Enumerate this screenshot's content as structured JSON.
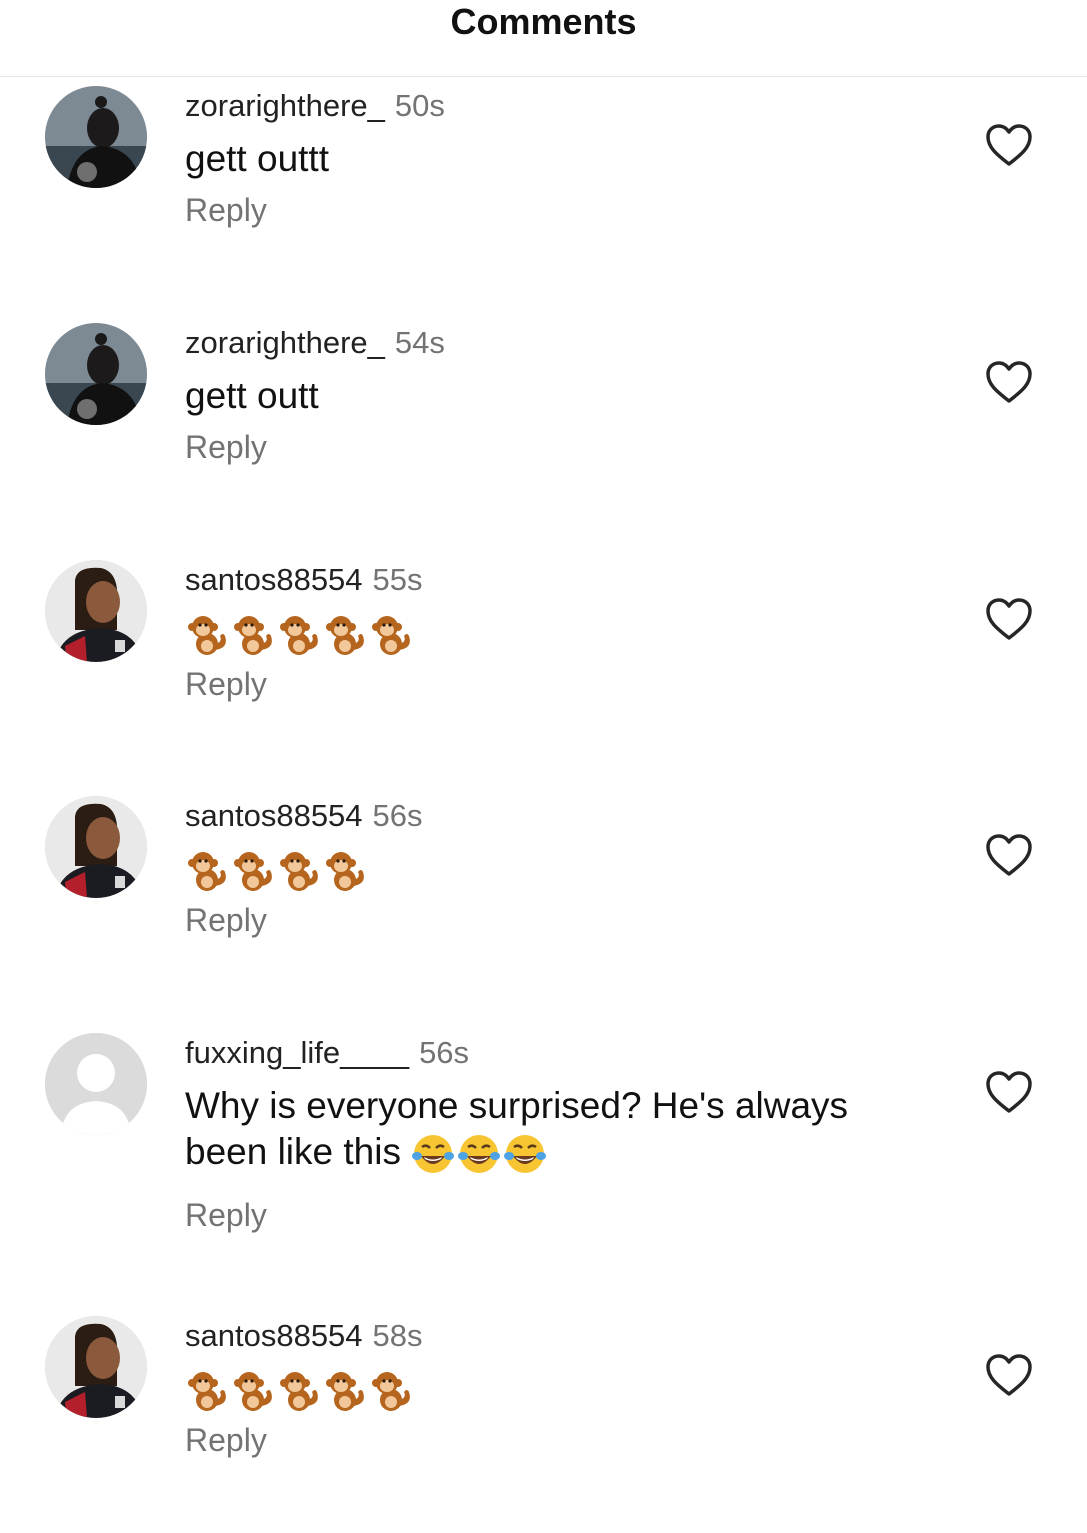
{
  "header": {
    "title": "Comments"
  },
  "comments": [
    {
      "username": "zorarighthere_",
      "time": "50s",
      "text": "gett outtt",
      "emoji_count": 0,
      "reply_label": "Reply",
      "avatar": "dark-figure-avatar"
    },
    {
      "username": "zorarighthere_",
      "time": "54s",
      "text": "gett outt",
      "emoji_count": 0,
      "reply_label": "Reply",
      "avatar": "dark-figure-avatar"
    },
    {
      "username": "santos88554",
      "time": "55s",
      "text": "",
      "emoji": "monkey",
      "emoji_count": 5,
      "reply_label": "Reply",
      "avatar": "player-avatar"
    },
    {
      "username": "santos88554",
      "time": "56s",
      "text": "",
      "emoji": "monkey",
      "emoji_count": 4,
      "reply_label": "Reply",
      "avatar": "player-avatar"
    },
    {
      "username": "fuxxing_life____",
      "time": "56s",
      "text": "Why is everyone surprised? He's always been like this",
      "emoji": "tears-of-joy",
      "emoji_count": 3,
      "reply_label": "Reply",
      "avatar": "default-avatar"
    },
    {
      "username": "santos88554",
      "time": "58s",
      "text": "",
      "emoji": "monkey",
      "emoji_count": 5,
      "reply_label": "Reply",
      "avatar": "player-avatar"
    }
  ],
  "icons": {
    "like": "heart-outline-icon",
    "monkey": "monkey-emoji",
    "laugh": "tears-of-joy-emoji"
  },
  "colors": {
    "text": "#111111",
    "secondary": "#737373",
    "divider": "#e6e6e6",
    "background": "#ffffff"
  }
}
